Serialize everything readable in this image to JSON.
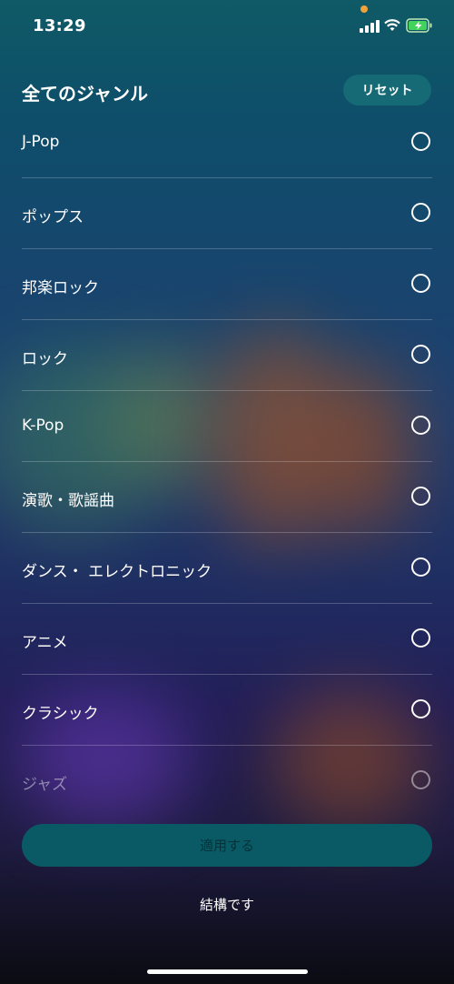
{
  "status_bar": {
    "time": "13:29"
  },
  "header": {
    "title": "全てのジャンル",
    "reset_label": "リセット"
  },
  "genres": [
    {
      "label": "J-Pop",
      "selected": false
    },
    {
      "label": "ポップス",
      "selected": false
    },
    {
      "label": "邦楽ロック",
      "selected": false
    },
    {
      "label": "ロック",
      "selected": false
    },
    {
      "label": "K-Pop",
      "selected": false
    },
    {
      "label": "演歌・歌謡曲",
      "selected": false
    },
    {
      "label": "ダンス・ エレクトロニック",
      "selected": false
    },
    {
      "label": "アニメ",
      "selected": false
    },
    {
      "label": "クラシック",
      "selected": false
    },
    {
      "label": "ジャズ",
      "selected": false
    }
  ],
  "footer": {
    "apply_label": "適用する",
    "decline_label": "結構です"
  },
  "colors": {
    "accent": "#166e78",
    "apply_bg": "#0a5a66",
    "status_dot": "#f0a23a"
  }
}
